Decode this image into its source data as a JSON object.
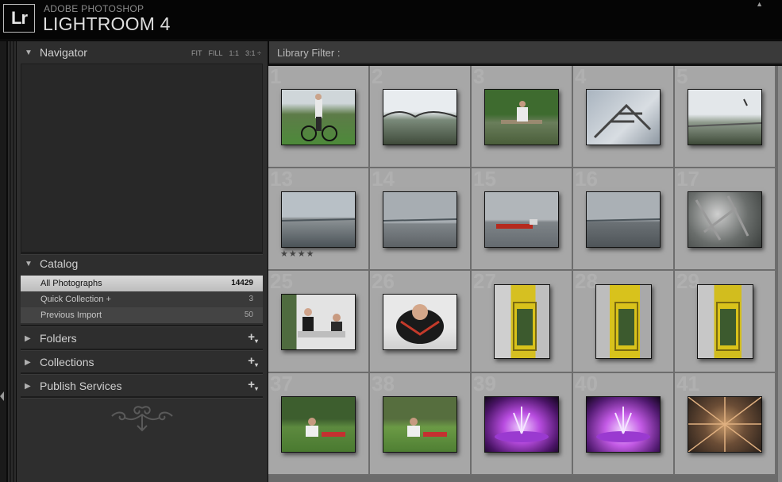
{
  "app": {
    "logo_text": "Lr",
    "brand_line1": "ADOBE PHOTOSHOP",
    "brand_line2": "LIGHTROOM 4"
  },
  "navigator": {
    "title": "Navigator",
    "options": [
      "FIT",
      "FILL",
      "1:1",
      "3:1 ÷"
    ]
  },
  "catalog": {
    "title": "Catalog",
    "items": [
      {
        "label": "All Photographs",
        "count": "14429"
      },
      {
        "label": "Quick Collection  +",
        "count": "3"
      },
      {
        "label": "Previous Import",
        "count": "50"
      }
    ]
  },
  "panels": [
    {
      "title": "Folders"
    },
    {
      "title": "Collections"
    },
    {
      "title": "Publish Services"
    }
  ],
  "library": {
    "filter_label": "Library Filter :"
  },
  "grid": {
    "rows": [
      [
        {
          "num": "1",
          "orient": "l",
          "bg": "linear-gradient(#cfd6d9 0 25%, #5d7b48 45%, #4d8a3a 100%)",
          "icon": "person-bicycle"
        },
        {
          "num": "2",
          "orient": "l",
          "bg": "linear-gradient(#e8ecef 0 40%, #7a8a7a 55%, #3f4a3a 100%)",
          "icon": "bridge"
        },
        {
          "num": "3",
          "orient": "l",
          "bg": "linear-gradient(#3e6b2f 0 45%, #6a7e5b 60%, #4a5e3a 100%)",
          "icon": "person-bench"
        },
        {
          "num": "4",
          "orient": "l",
          "bg": "linear-gradient(135deg,#a9b4bf,#d8dde2 60%,#8e98a2)",
          "icon": "crane"
        },
        {
          "num": "5",
          "orient": "l",
          "bg": "linear-gradient(#e3e7ea 0 45%, #8e9a8c 60%, #3e4a38 100%)",
          "icon": "harbor"
        }
      ],
      [
        {
          "num": "13",
          "orient": "l",
          "bg": "linear-gradient(#b8c0c6 0 45%, #8e9497 48%, #4b5358 100%)",
          "icon": "river"
        },
        {
          "num": "14",
          "orient": "l",
          "bg": "linear-gradient(#a7adb2 0 55%, #7f8589 58%, #5d6266 100%)",
          "icon": "river"
        },
        {
          "num": "15",
          "orient": "l",
          "bg": "linear-gradient(#b1b6ba 0 50%, #7e8488 55%, #656b70 100%)",
          "icon": "ship"
        },
        {
          "num": "16",
          "orient": "l",
          "bg": "linear-gradient(#aab0b5 0 50%, #6b7175 55%, #4f5559 100%)",
          "icon": "river"
        },
        {
          "num": "17",
          "orient": "l",
          "bg": "radial-gradient(circle at 40% 40%, #cfcfcf, #6a6e6c 55%, #3b3f3d)",
          "icon": "rain"
        }
      ],
      [
        {
          "num": "25",
          "orient": "l",
          "bg": "linear-gradient(90deg,#4f6b3f 0 20%, #e3e3e3 20% 100%)",
          "icon": "people-sitting"
        },
        {
          "num": "26",
          "orient": "l",
          "bg": "linear-gradient(#e8e8e8 0 60%, #d0d0d0 100%)",
          "icon": "person-lying"
        },
        {
          "num": "27",
          "orient": "p",
          "bg": "linear-gradient(90deg,#cfcfcf 0 30%, #d6c021 30% 75%, #bfbfbf 75%)",
          "icon": "phone-booth"
        },
        {
          "num": "28",
          "orient": "p",
          "bg": "linear-gradient(90deg,#bdbdbd 0 25%, #d8c21c 25% 80%, #a9a9a9 80%)",
          "icon": "phone-booth"
        },
        {
          "num": "29",
          "orient": "p",
          "bg": "linear-gradient(90deg,#c7c7c7 0 30%, #d2bd1e 30% 80%, #b0b0b0 80%)",
          "icon": "phone-booth"
        }
      ],
      [
        {
          "num": "37",
          "orient": "l",
          "bg": "linear-gradient(#3d5e2e 0 40%, #5d8a3f 55%, #4a7a30 100%)",
          "icon": "picnic"
        },
        {
          "num": "38",
          "orient": "l",
          "bg": "linear-gradient(#566e3e 0 40%, #6b9a45 55%, #4f7f33 100%)",
          "icon": "picnic"
        },
        {
          "num": "39",
          "orient": "l",
          "bg": "radial-gradient(ellipse at 50% 55%, #f0d0ff, #b84ce0 35%, #4a1466 75%, #12061c)",
          "icon": "fountain"
        },
        {
          "num": "40",
          "orient": "l",
          "bg": "radial-gradient(ellipse at 50% 60%, #f3d9ff, #c45be6 35%, #511a70 75%, #12061c)",
          "icon": "fountain"
        },
        {
          "num": "41",
          "orient": "l",
          "bg": "radial-gradient(circle at 50% 50%, #c89a6a, #6b4d36 45%, #2a211b)",
          "icon": "abstract"
        }
      ]
    ],
    "row1_rating": "★★★★"
  }
}
